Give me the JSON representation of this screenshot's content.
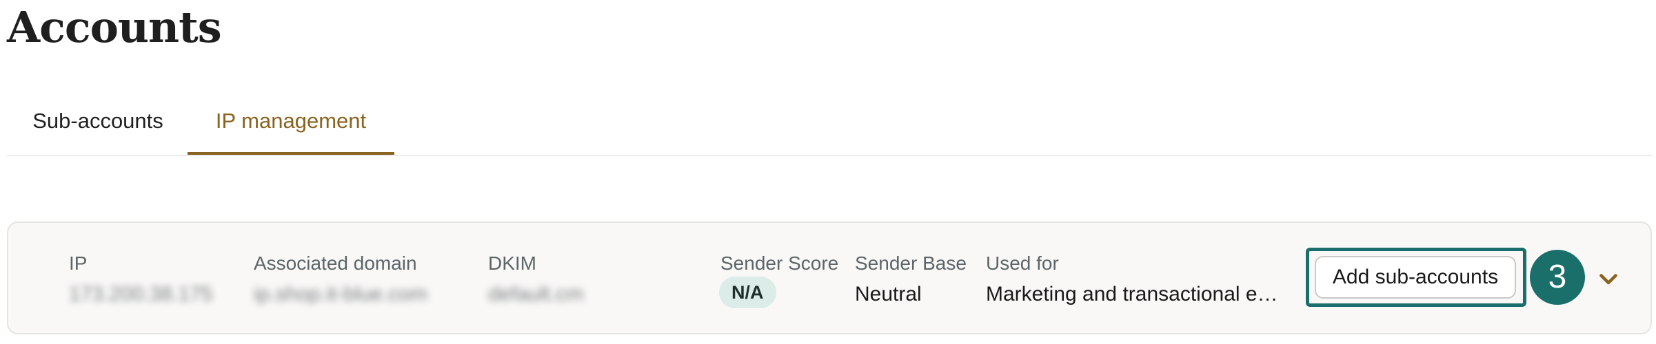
{
  "page": {
    "title": "Accounts"
  },
  "tabs": [
    {
      "label": "Sub-accounts",
      "active": false
    },
    {
      "label": "IP management",
      "active": true
    }
  ],
  "ip_row": {
    "columns": {
      "ip": {
        "label": "IP",
        "value": "173.200.38.175"
      },
      "domain": {
        "label": "Associated domain",
        "value": "ip.shop.it-blue.com"
      },
      "dkim": {
        "label": "DKIM",
        "value": "default.cm"
      },
      "sender_score": {
        "label": "Sender Score",
        "value": "N/A"
      },
      "sender_base": {
        "label": "Sender Base",
        "value": "Neutral"
      },
      "used_for": {
        "label": "Used for",
        "value": "Marketing and transactional e…"
      }
    },
    "add_button_label": "Add sub-accounts",
    "step_number": "3"
  },
  "colors": {
    "accent_tab": "#8a6320",
    "highlight": "#1a6f6a",
    "badge_bg": "#dcece8"
  },
  "icons": {
    "expand": "chevron-down-icon"
  }
}
